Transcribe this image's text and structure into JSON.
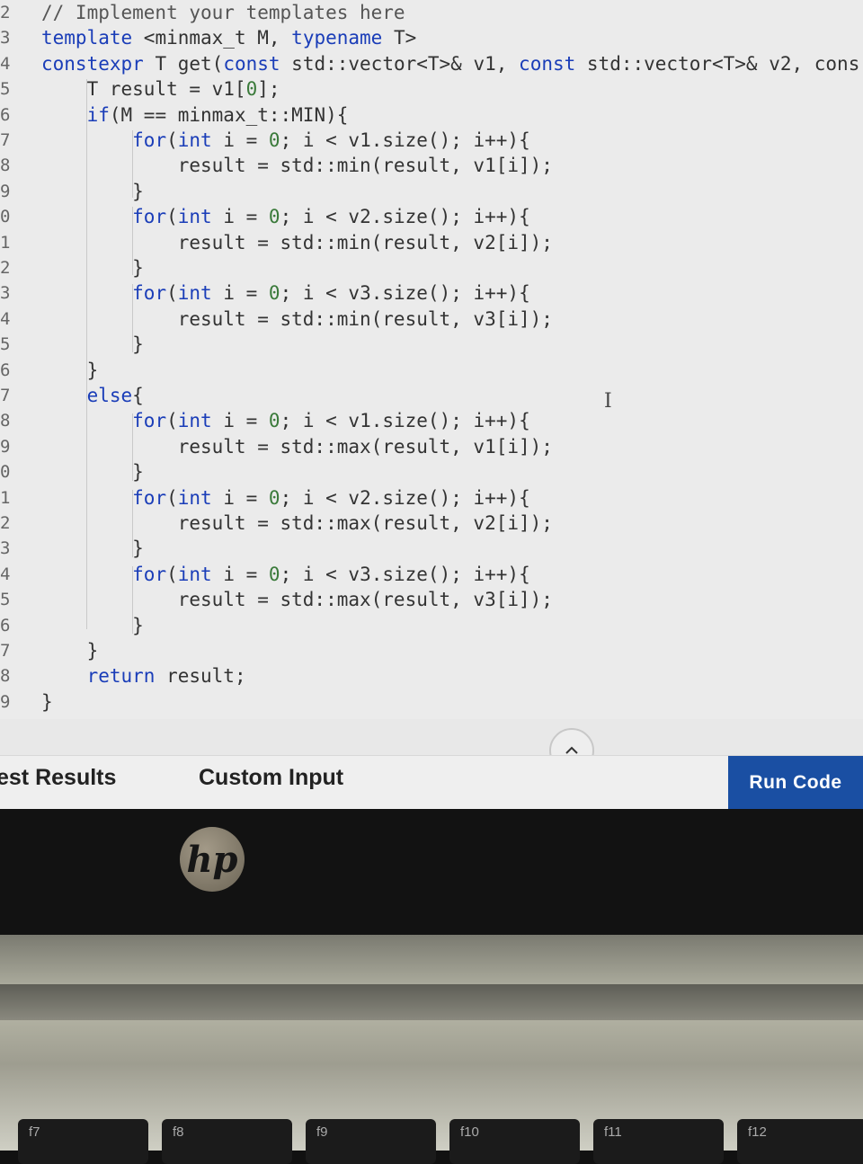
{
  "editor": {
    "line_numbers": [
      "2",
      "3",
      "4",
      "5",
      "6",
      "7",
      "8",
      "9",
      "0",
      "1",
      "2",
      "3",
      "4",
      "5",
      "6",
      "7",
      "8",
      "9",
      "0",
      "1",
      "2",
      "3",
      "4",
      "5",
      "6",
      "7",
      "8",
      "9"
    ],
    "lines": [
      "// Implement your templates here",
      "template <minmax_t M, typename T>",
      "constexpr T get(const std::vector<T>& v1, const std::vector<T>& v2, cons",
      "    T result = v1[0];",
      "    if(M == minmax_t::MIN){",
      "        for(int i = 0; i < v1.size(); i++){",
      "            result = std::min(result, v1[i]);",
      "        }",
      "        for(int i = 0; i < v2.size(); i++){",
      "            result = std::min(result, v2[i]);",
      "        }",
      "        for(int i = 0; i < v3.size(); i++){",
      "            result = std::min(result, v3[i]);",
      "        }",
      "    }",
      "    else{",
      "        for(int i = 0; i < v1.size(); i++){",
      "            result = std::max(result, v1[i]);",
      "        }",
      "        for(int i = 0; i < v2.size(); i++){",
      "            result = std::max(result, v2[i]);",
      "        }",
      "        for(int i = 0; i < v3.size(); i++){",
      "            result = std::max(result, v3[i]);",
      "        }",
      "    }",
      "    return result;",
      "}"
    ]
  },
  "collapse_icon": "chevron-up-icon",
  "tabs": {
    "test_results": "est Results",
    "custom_input": "Custom Input"
  },
  "run_button": "Run Code",
  "laptop": {
    "logo": "hp",
    "keys": [
      "f7",
      "f8",
      "f9",
      "f10",
      "f11",
      "f12"
    ]
  },
  "colors": {
    "accent": "#1a4fa3",
    "keyword": "#1a3db8",
    "number": "#3a7a3a"
  }
}
